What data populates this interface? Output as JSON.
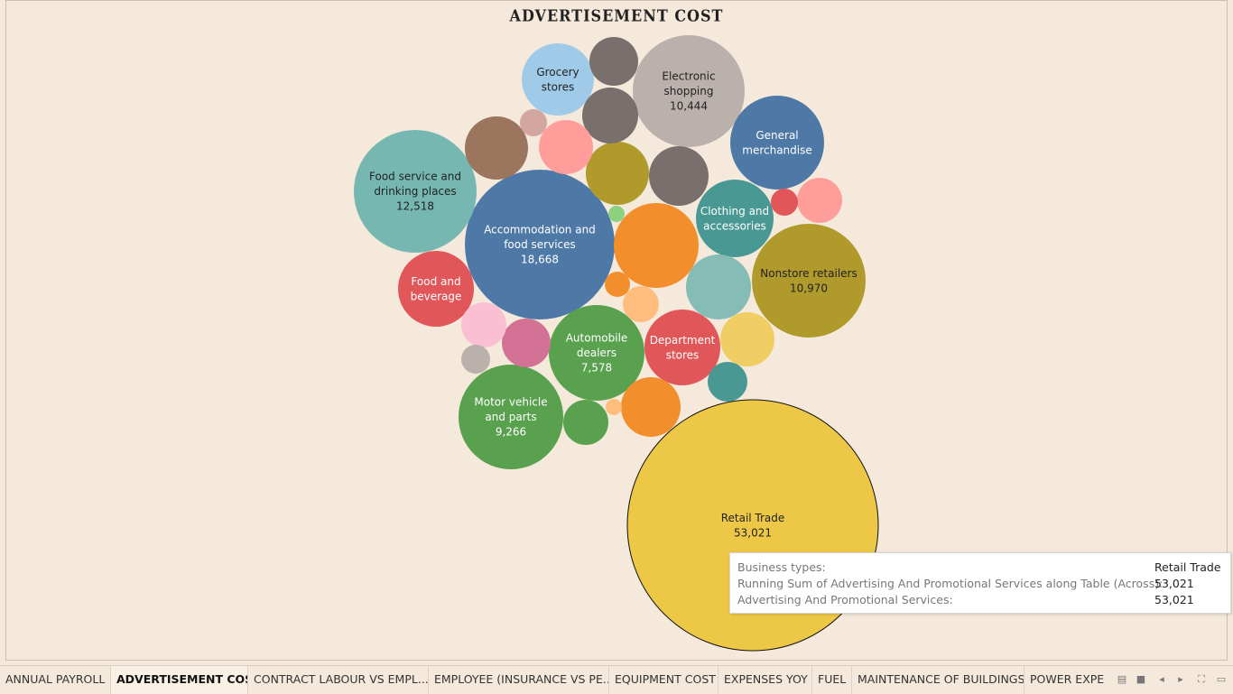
{
  "title": "ADVERTISEMENT COST",
  "chart_data": {
    "type": "bubble",
    "title": "ADVERTISEMENT COST",
    "measure": "Advertising And Promotional Services",
    "bubbles": [
      {
        "name": "Retail Trade",
        "value": 53021,
        "label": "Retail Trade",
        "value_label": "53,021",
        "color": "#ecc846",
        "text": "#222",
        "highlight": true
      },
      {
        "name": "Accommodation and food services",
        "value": 18668,
        "label": "Accommodation and food services",
        "value_label": "18,668",
        "color": "#4e79a7",
        "text": "#fff"
      },
      {
        "name": "Food service and drinking places",
        "value": 12518,
        "label": "Food service and drinking places",
        "value_label": "12,518",
        "color": "#76b7b2",
        "text": "#222"
      },
      {
        "name": "Nonstore retailers",
        "value": 10970,
        "label": "Nonstore retailers",
        "value_label": "10,970",
        "color": "#b09a2c",
        "text": "#222"
      },
      {
        "name": "Electronic shopping",
        "value": 10444,
        "label": "Electronic shopping",
        "value_label": "10,444",
        "color": "#bab0ac",
        "text": "#222"
      },
      {
        "name": "Motor vehicle and parts",
        "value": 9266,
        "label": "Motor vehicle and parts",
        "value_label": "9,266",
        "color": "#59a14f",
        "text": "#fff"
      },
      {
        "name": "Automobile dealers",
        "value": 7578,
        "label": "Automobile dealers",
        "value_label": "7,578",
        "color": "#59a14f",
        "text": "#fff"
      },
      {
        "name": "General merchandise",
        "label": "General merchandise",
        "color": "#4e79a7",
        "text": "#fff"
      },
      {
        "name": "Clothing and accessories",
        "label": "Clothing and accessories",
        "color": "#499894",
        "text": "#fff"
      },
      {
        "name": "Department stores",
        "label": "Department stores",
        "color": "#e15759",
        "text": "#fff"
      },
      {
        "name": "Food and beverage",
        "label": "Food and beverage",
        "color": "#e15759",
        "text": "#fff"
      },
      {
        "name": "Grocery stores",
        "label": "Grocery stores",
        "color": "#a0cbe8",
        "text": "#222"
      },
      {
        "color": "#f28e2b"
      },
      {
        "color": "#79706e"
      },
      {
        "color": "#86bcb6"
      },
      {
        "color": "#b09a2c"
      },
      {
        "color": "#79706e"
      },
      {
        "color": "#9c755f"
      },
      {
        "color": "#79706e"
      },
      {
        "color": "#ff9d9a"
      },
      {
        "color": "#f1ce63"
      },
      {
        "color": "#f28e2b"
      },
      {
        "color": "#d37295"
      },
      {
        "color": "#fabfd2"
      },
      {
        "color": "#ff9d9a"
      },
      {
        "color": "#59a14f"
      },
      {
        "color": "#499894"
      },
      {
        "color": "#ffbe7d"
      },
      {
        "color": "#e15759"
      },
      {
        "color": "#d4a6a0"
      },
      {
        "color": "#bab0ac"
      },
      {
        "color": "#f28e2b"
      },
      {
        "color": "#ffbe7d"
      },
      {
        "color": "#8cd17d"
      }
    ]
  },
  "tooltip": {
    "rows": [
      {
        "key": "Business types:",
        "value": "Retail Trade"
      },
      {
        "key": "Running Sum of Advertising And Promotional Services along Table (Across):",
        "value": "53,021"
      },
      {
        "key": "Advertising And Promotional Services:",
        "value": "53,021"
      }
    ]
  },
  "tabs": [
    {
      "label": "ANNUAL PAYROLL",
      "active": false
    },
    {
      "label": "ADVERTISEMENT COST",
      "active": true
    },
    {
      "label": "CONTRACT LABOUR VS EMPL...",
      "active": false
    },
    {
      "label": "EMPLOYEE (INSURANCE VS PE...",
      "active": false
    },
    {
      "label": "EQUIPMENT COST",
      "active": false
    },
    {
      "label": "EXPENSES YOY",
      "active": false
    },
    {
      "label": "FUEL",
      "active": false
    },
    {
      "label": "MAINTENANCE OF BUILDINGS",
      "active": false
    },
    {
      "label": "POWER EXPEN",
      "active": false
    }
  ],
  "controls": [
    {
      "name": "grid-view-icon",
      "glyph": "▤"
    },
    {
      "name": "single-view-icon",
      "glyph": "■"
    },
    {
      "name": "prev-sheet-icon",
      "glyph": "◂"
    },
    {
      "name": "next-sheet-icon",
      "glyph": "▸"
    },
    {
      "name": "fullscreen-icon",
      "glyph": "⛶"
    },
    {
      "name": "presentation-icon",
      "glyph": "▭"
    }
  ]
}
